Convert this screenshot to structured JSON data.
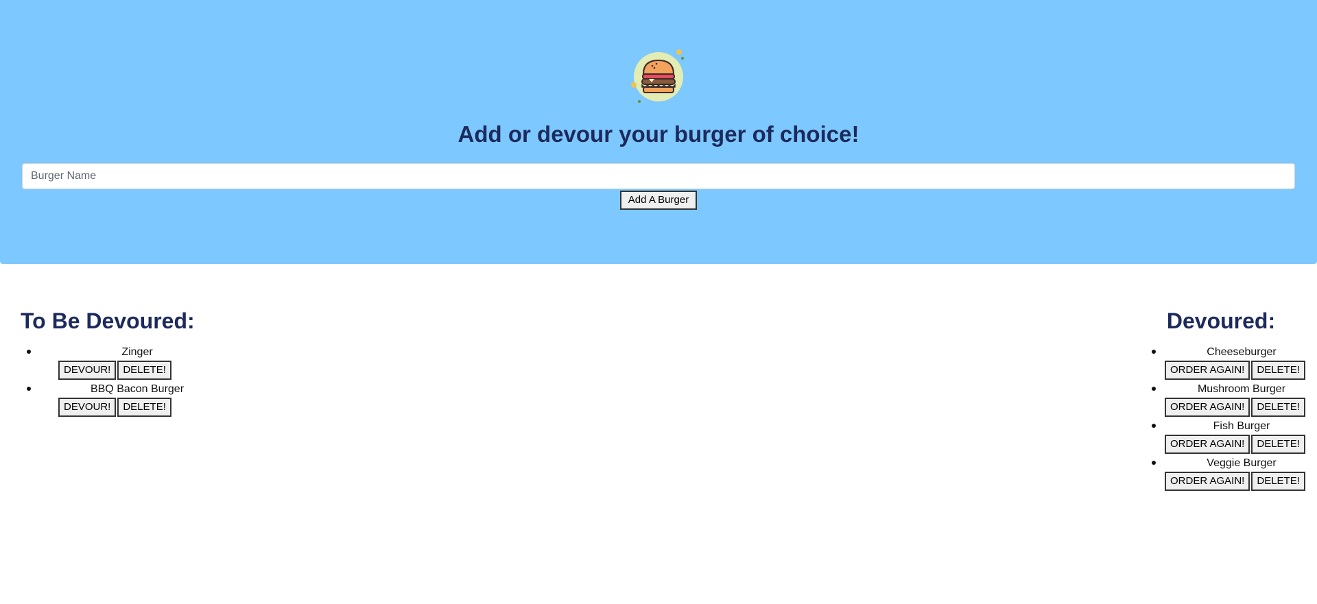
{
  "header": {
    "title": "Add or devour your burger of choice!",
    "logo_icon": "burger-icon"
  },
  "form": {
    "placeholder": "Burger Name",
    "value": "",
    "submit_label": "Add A Burger"
  },
  "to_devour": {
    "title": "To Be Devoured:",
    "items": [
      {
        "name": "Zinger",
        "action_label": "DEVOUR!",
        "delete_label": "DELETE!"
      },
      {
        "name": "BBQ Bacon Burger",
        "action_label": "DEVOUR!",
        "delete_label": "DELETE!"
      }
    ]
  },
  "devoured": {
    "title": "Devoured:",
    "items": [
      {
        "name": "Cheeseburger",
        "action_label": "ORDER AGAIN!",
        "delete_label": "DELETE!"
      },
      {
        "name": "Mushroom Burger",
        "action_label": "ORDER AGAIN!",
        "delete_label": "DELETE!"
      },
      {
        "name": "Fish Burger",
        "action_label": "ORDER AGAIN!",
        "delete_label": "DELETE!"
      },
      {
        "name": "Veggie Burger",
        "action_label": "ORDER AGAIN!",
        "delete_label": "DELETE!"
      }
    ]
  },
  "colors": {
    "hero_bg": "#7dc8ff",
    "heading": "#1d2a5c",
    "logo_circle": "#e3ecb3"
  }
}
